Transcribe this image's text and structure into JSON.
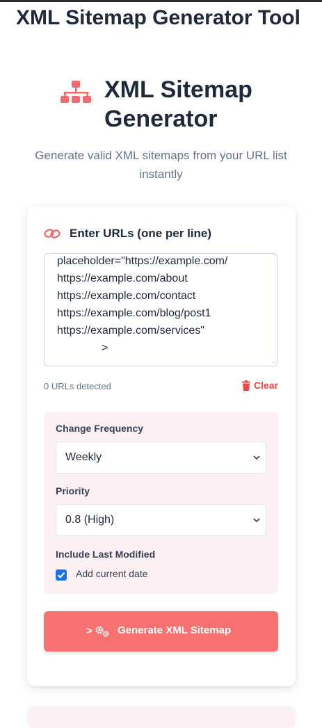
{
  "page": {
    "title": "XML Sitemap Generator Tool"
  },
  "hero": {
    "icon": "sitemap-icon",
    "title": "XML Sitemap Generator",
    "subtitle": "Generate valid XML sitemaps from your URL list instantly"
  },
  "url_input": {
    "icon": "link-icon",
    "label": "Enter URLs (one per line)",
    "lines": [
      "placeholder=\"https://example.com/",
      "https://example.com/about",
      "https://example.com/contact",
      "https://example.com/blog/post1",
      "https://example.com/services\"",
      ">"
    ],
    "count_text": "0 URLs detected",
    "clear_label": "Clear"
  },
  "options": {
    "frequency_label": "Change Frequency",
    "frequency_value": "Weekly",
    "priority_label": "Priority",
    "priority_value": "0.8 (High)",
    "last_modified_label": "Include Last Modified",
    "last_modified_checkbox_label": "Add current date",
    "last_modified_checked": true
  },
  "generate_button": {
    "prefix": ">",
    "icon": "cogs-icon",
    "label": "Generate XML Sitemap"
  },
  "colors": {
    "accent": "#f87171",
    "danger": "#ef4444",
    "options_bg": "#fdf0f3",
    "checkbox": "#1a73e8"
  }
}
